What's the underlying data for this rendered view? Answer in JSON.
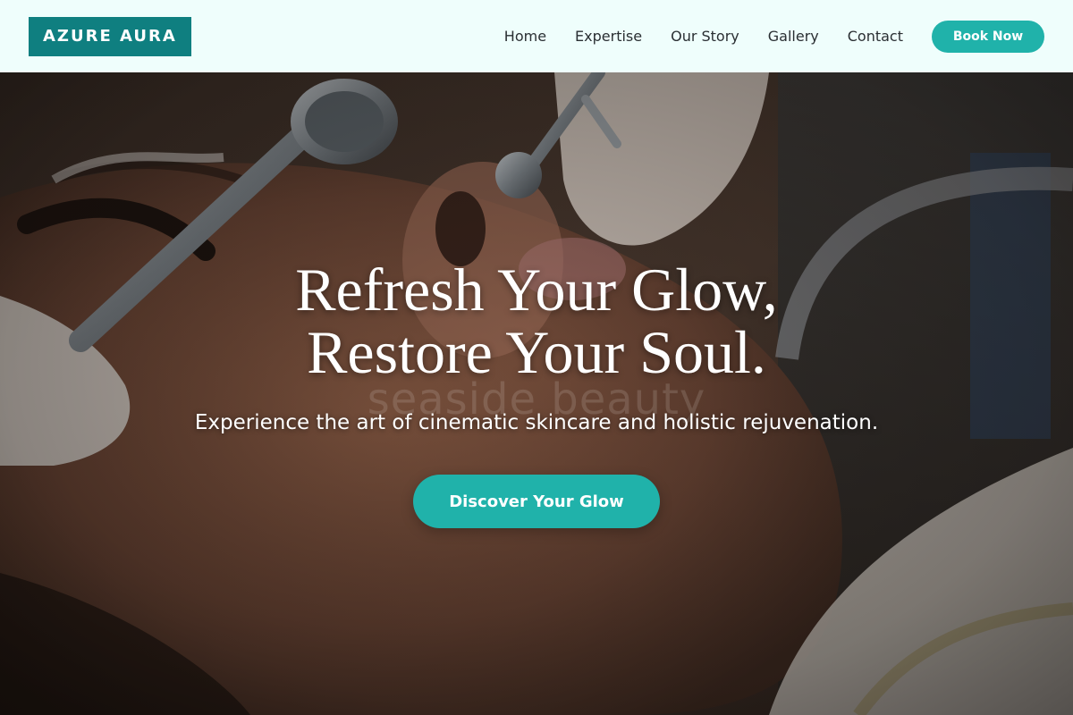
{
  "brand": {
    "name": "AZURE AURA"
  },
  "nav": {
    "items": [
      {
        "label": "Home"
      },
      {
        "label": "Expertise"
      },
      {
        "label": "Our Story"
      },
      {
        "label": "Gallery"
      },
      {
        "label": "Contact"
      }
    ],
    "cta_label": "Book Now"
  },
  "hero": {
    "title_line1": "Refresh Your Glow,",
    "title_line2": "Restore Your Soul.",
    "watermark": "seaside beauty",
    "subtitle": "Experience the art of cinematic skincare and holistic rejuvenation.",
    "cta_label": "Discover Your Glow",
    "image": "facial-treatment-photo"
  },
  "colors": {
    "header_bg": "#effefc",
    "brand_bg": "#0f7f80",
    "accent": "#20b2aa",
    "nav_text": "#2a2f33"
  }
}
